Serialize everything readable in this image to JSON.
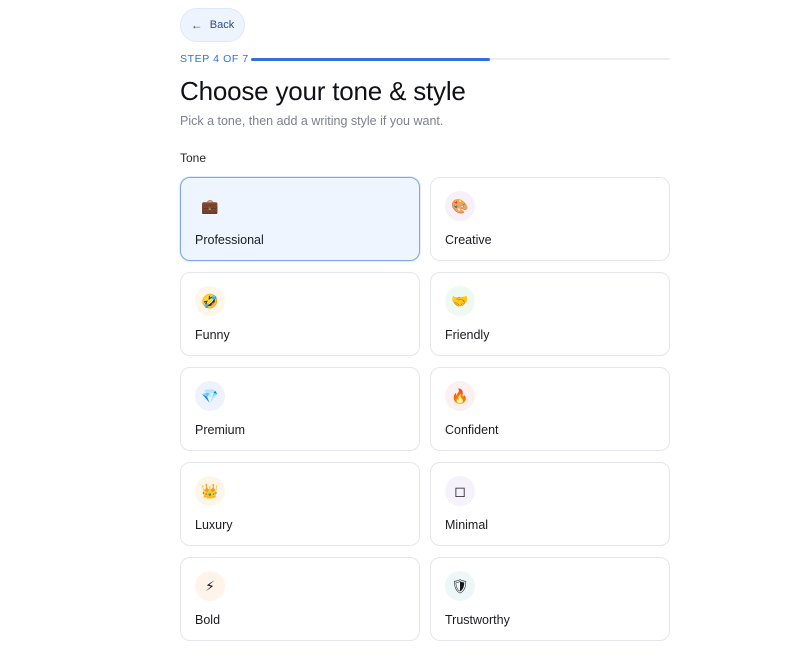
{
  "header": {
    "back_label": "Back",
    "step_label": "STEP 4 OF 7",
    "progress_fraction": 0.571
  },
  "title": "Choose your tone & style",
  "subtitle": "Pick a tone, then add a writing style if you want.",
  "tone_section": {
    "label": "Tone",
    "options": [
      {
        "label": "Professional",
        "icon": "briefcase-icon",
        "glyph": "💼",
        "icon_bg": "#eef5ff",
        "selected": true
      },
      {
        "label": "Creative",
        "icon": "palette-icon",
        "glyph": "🎨",
        "icon_bg": "#f7f0fb",
        "selected": false
      },
      {
        "label": "Funny",
        "icon": "laughing-face-icon",
        "glyph": "🤣",
        "icon_bg": "#fff6ea",
        "selected": false
      },
      {
        "label": "Friendly",
        "icon": "handshake-icon",
        "glyph": "🤝",
        "icon_bg": "#edf9f1",
        "selected": false
      },
      {
        "label": "Premium",
        "icon": "gem-icon",
        "glyph": "💎",
        "icon_bg": "#eef2fd",
        "selected": false
      },
      {
        "label": "Confident",
        "icon": "fire-icon",
        "glyph": "🔥",
        "icon_bg": "#fdf0f0",
        "selected": false
      },
      {
        "label": "Luxury",
        "icon": "crown-icon",
        "glyph": "👑",
        "icon_bg": "#fdf6e8",
        "selected": false
      },
      {
        "label": "Minimal",
        "icon": "square-icon",
        "glyph": "◻",
        "icon_bg": "#f5f2fb",
        "selected": false
      },
      {
        "label": "Bold",
        "icon": "lightning-icon",
        "glyph": "⚡",
        "icon_bg": "#fff3ea",
        "selected": false
      },
      {
        "label": "Trustworthy",
        "icon": "shield-icon",
        "glyph": "🛡",
        "icon_bg": "#edf7f8",
        "selected": false
      }
    ]
  }
}
